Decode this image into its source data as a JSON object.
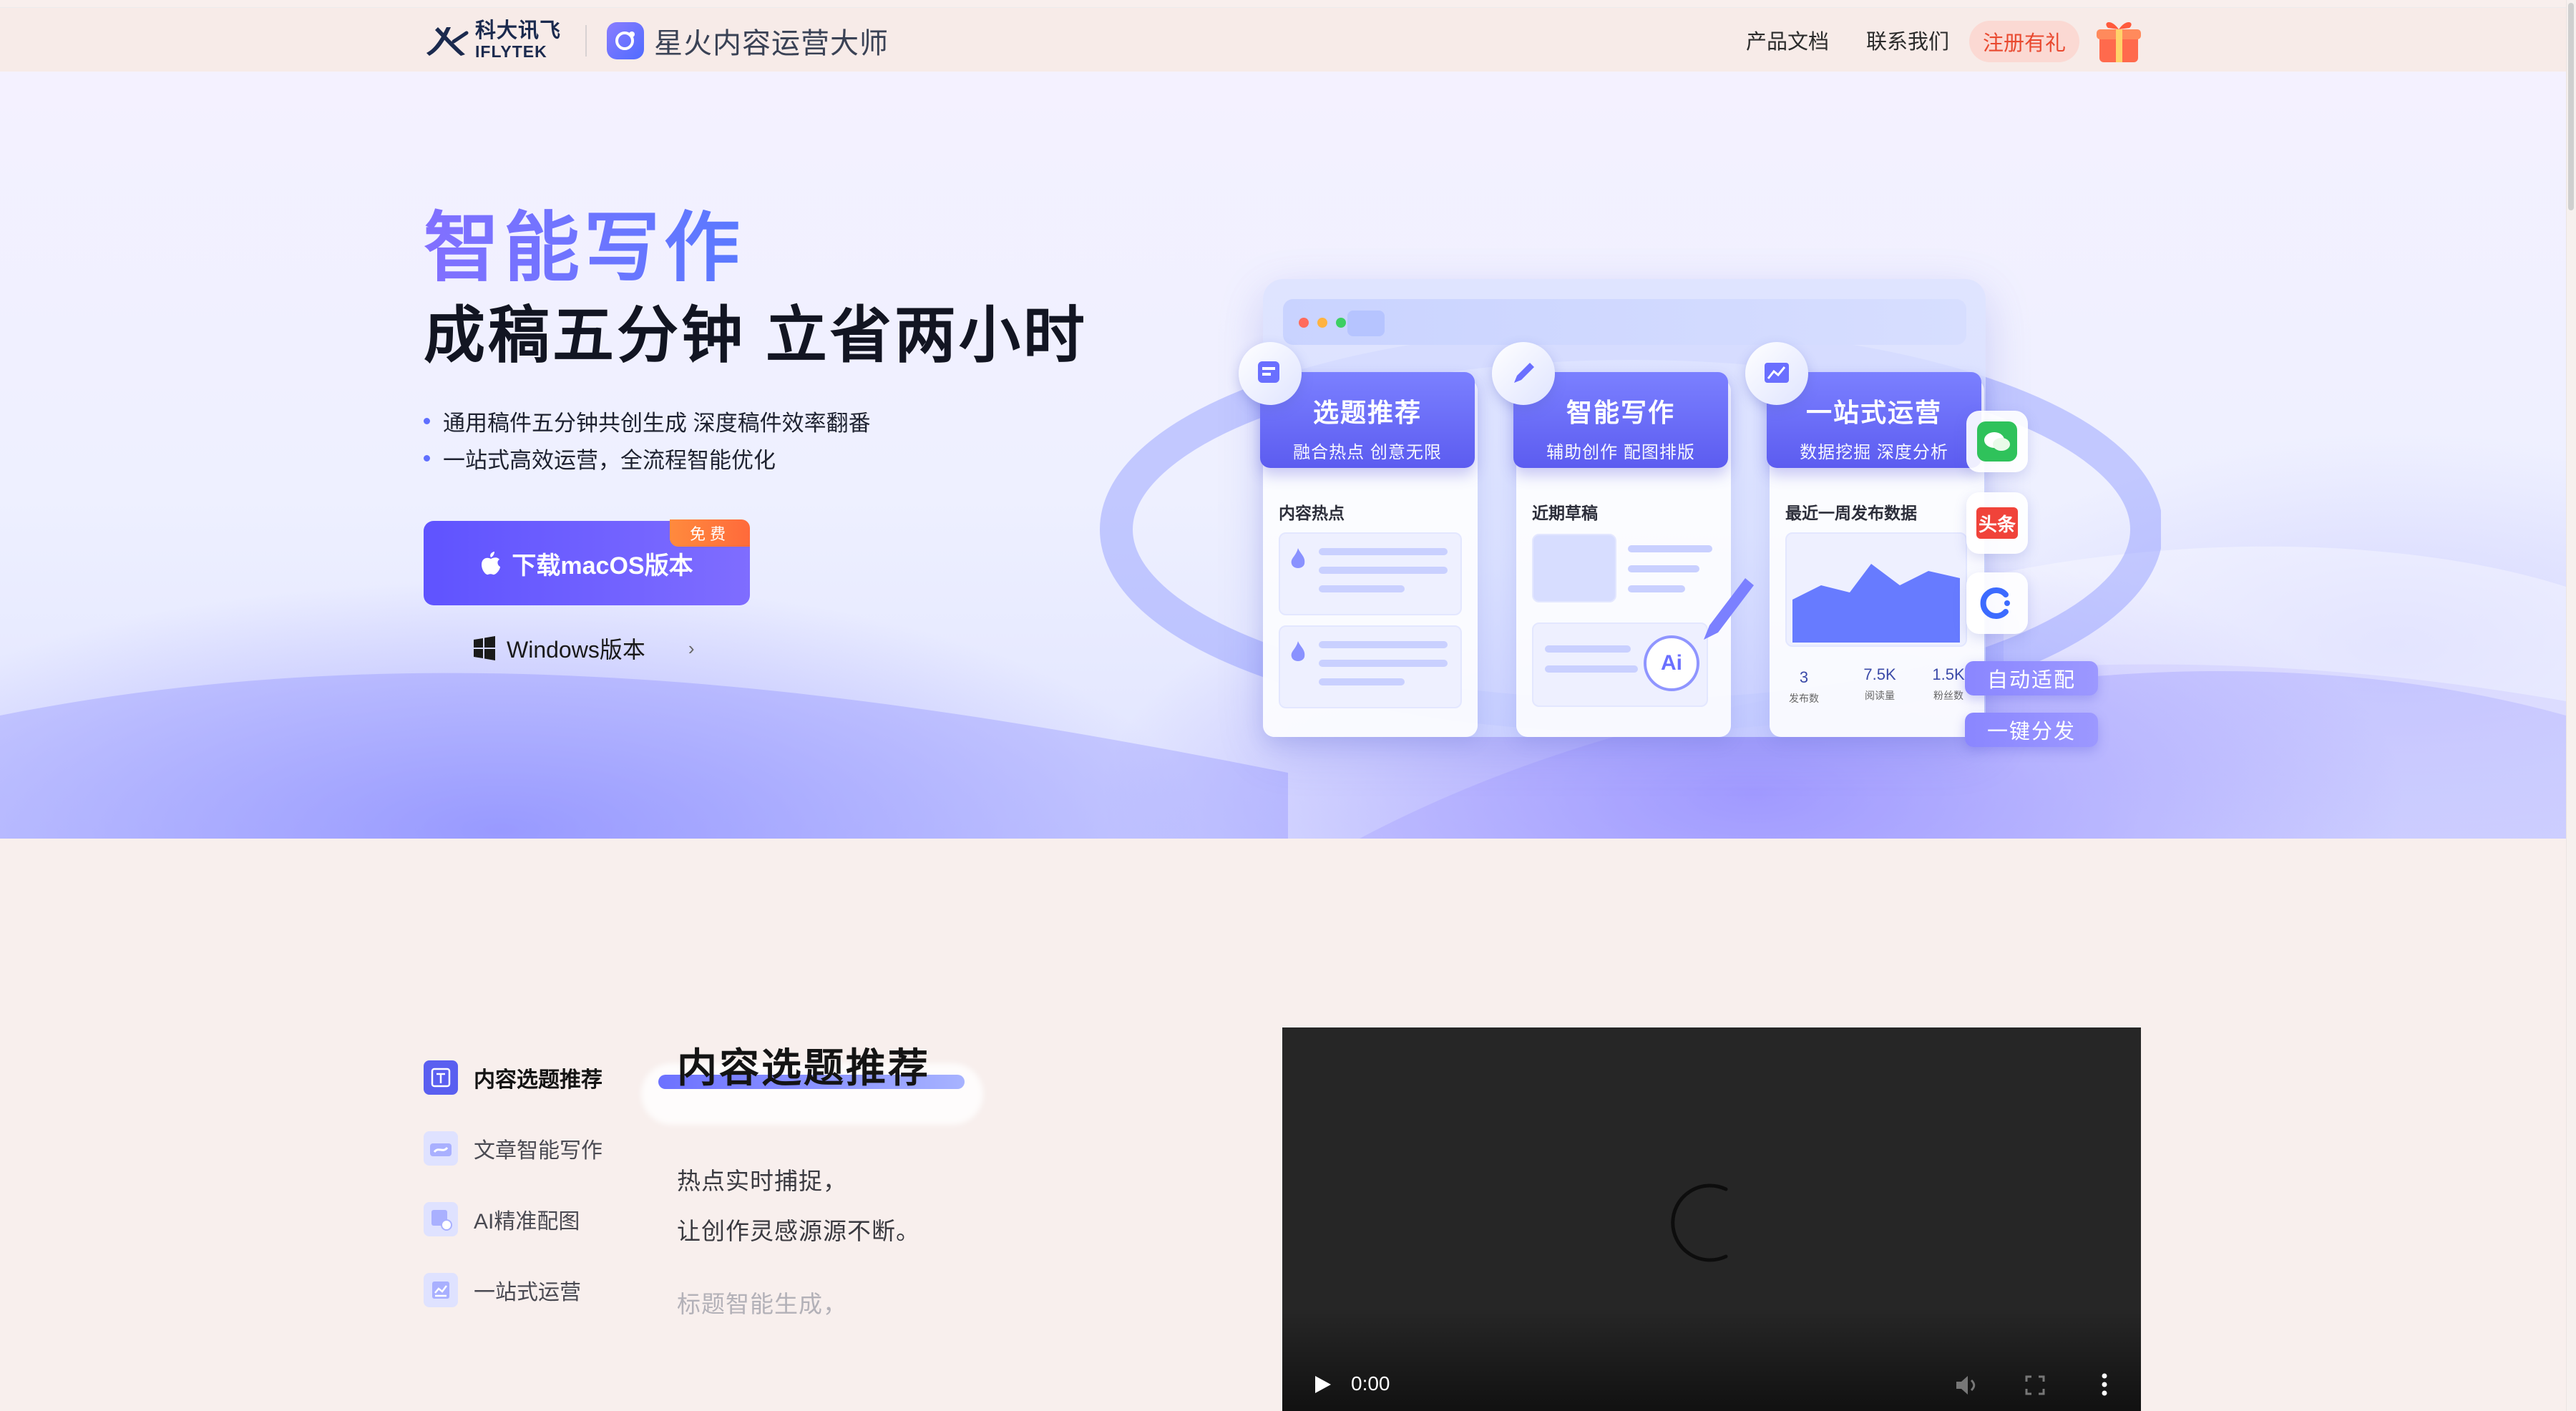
{
  "header": {
    "brand_cn": "科大讯飞",
    "brand_en": "IFLYTEK",
    "product_name": "星火内容运营大师",
    "nav": [
      "产品文档",
      "联系我们"
    ],
    "register_label": "注册有礼",
    "gift_icon": "gift-icon"
  },
  "hero": {
    "title": "智能写作",
    "subtitle": "成稿五分钟 立省两小时",
    "bullets": [
      "通用稿件五分钟共创生成 深度稿件效率翻番",
      "一站式高效运营，全流程智能优化"
    ],
    "mac_button": "下载macOS版本",
    "free_badge": "免费",
    "windows_link": "Windows版本",
    "illustration": {
      "cards": [
        {
          "title": "选题推荐",
          "subtitle": "融合热点 创意无限",
          "label": "内容热点"
        },
        {
          "title": "智能写作",
          "subtitle": "辅助创作 配图排版",
          "label": "近期草稿"
        },
        {
          "title": "一站式运营",
          "subtitle": "数据挖掘 深度分析",
          "label": "最近一周发布数据"
        }
      ],
      "stats": [
        {
          "value": "3",
          "label": "发布数"
        },
        {
          "value": "7.5K",
          "label": "阅读量"
        },
        {
          "value": "1.5K",
          "label": "粉丝数"
        }
      ],
      "ai_badge": "Ai",
      "toutiao": "头条",
      "pills": [
        "自动适配",
        "一键分发"
      ]
    }
  },
  "features": {
    "items": [
      {
        "label": "内容选题推荐",
        "icon": "topic-icon",
        "active": true
      },
      {
        "label": "文章智能写作",
        "icon": "writing-icon",
        "active": false
      },
      {
        "label": "AI精准配图",
        "icon": "image-icon",
        "active": false
      },
      {
        "label": "一站式运营",
        "icon": "chart-icon",
        "active": false
      }
    ],
    "heading": "内容选题推荐",
    "desc_lines": [
      "热点实时捕捉，",
      "让创作灵感源源不断。"
    ],
    "desc_faded": "标题智能生成，"
  },
  "video": {
    "time": "0:00"
  },
  "colors": {
    "accent": "#5f53ff",
    "register_text": "#e9492f",
    "register_bg": "#fbd9d3",
    "badge": "#ff7a3d"
  }
}
